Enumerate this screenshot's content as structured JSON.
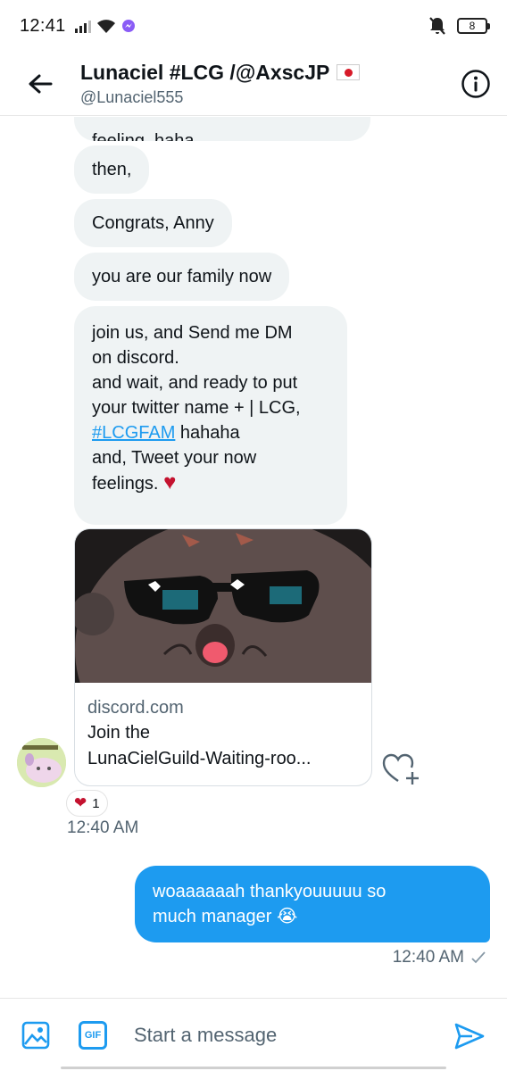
{
  "status_bar": {
    "time": "12:41",
    "battery": "8"
  },
  "header": {
    "name": "Lunaciel #LCG /@AxscJP",
    "handle": "@Lunaciel555"
  },
  "messages": {
    "partial": "feeling, haha",
    "m1": "then,",
    "m2": "Congrats, Anny",
    "m3": "you are our family now",
    "m4": {
      "line1": "join us, and Send me DM",
      "line2": "on discord.",
      "line3": "and wait, and ready to put",
      "line4": "your twitter name + |  LCG,",
      "hashtag": "#LCGFAM",
      "line5_rest": " hahaha",
      "line6": "and, Tweet your now",
      "line7": "feelings.",
      "heart": "♥"
    }
  },
  "link_card": {
    "domain": "discord.com",
    "title_line1": "Join the",
    "title_line2": "LunaCielGuild-Waiting-roo..."
  },
  "reaction": {
    "emoji": "❤",
    "count": "1"
  },
  "incoming_time": "12:40 AM",
  "outgoing": {
    "line1": "woaaaaaah thankyouuuuu so",
    "line2": "much manager 😭",
    "time": "12:40 AM"
  },
  "composer": {
    "placeholder": "Start a message",
    "gif_label": "GIF"
  },
  "colors": {
    "accent": "#1d9bf0",
    "bubble_in": "#eff3f4",
    "heart": "#c4122f"
  }
}
